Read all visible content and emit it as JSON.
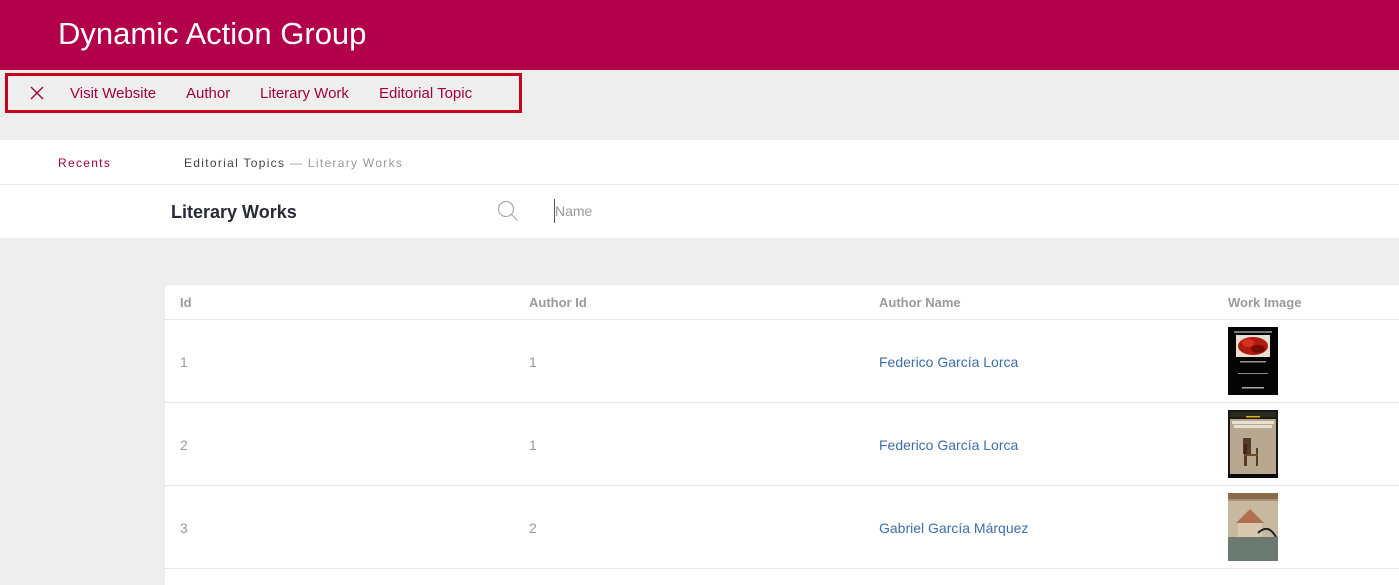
{
  "app": {
    "title": "Dynamic Action Group"
  },
  "actions": {
    "close_icon": "close-icon",
    "items": [
      {
        "label": "Visit Website"
      },
      {
        "label": "Author"
      },
      {
        "label": "Literary Work"
      },
      {
        "label": "Editorial Topic"
      }
    ]
  },
  "breadcrumb": {
    "recents": "Recents",
    "parent": "Editorial Topics",
    "separator": "—",
    "current": "Literary Works"
  },
  "page": {
    "title": "Literary Works",
    "search_placeholder": "Name",
    "search_value": ""
  },
  "table": {
    "columns": [
      "Id",
      "Author Id",
      "Author Name",
      "Work Image"
    ],
    "rows": [
      {
        "id": "1",
        "author_id": "1",
        "author_name": "Federico García Lorca",
        "image": "book-cover-red-flowers"
      },
      {
        "id": "2",
        "author_id": "1",
        "author_name": "Federico García Lorca",
        "image": "book-cover-chair"
      },
      {
        "id": "3",
        "author_id": "2",
        "author_name": "Gabriel García Márquez",
        "image": "book-cover-house"
      }
    ]
  },
  "colors": {
    "brand": "#b3004a",
    "accent_text": "#a3003f",
    "link": "#3d6ea8",
    "highlight_border": "#c8001e"
  }
}
